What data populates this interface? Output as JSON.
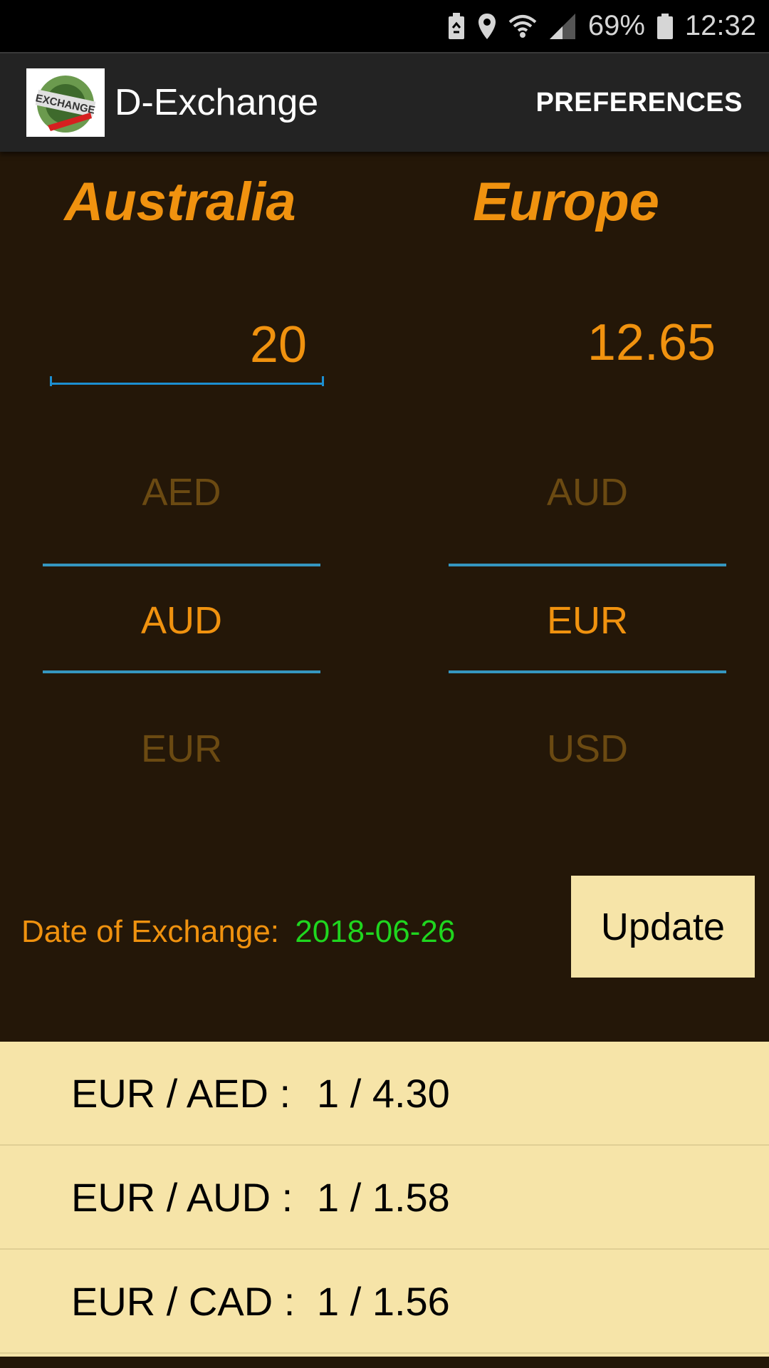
{
  "status_bar": {
    "battery_percent": "69%",
    "time": "12:32",
    "icons": [
      "battery-saver-icon",
      "location-icon",
      "wifi-icon",
      "signal-icon",
      "battery-icon"
    ]
  },
  "app_bar": {
    "title": "D-Exchange",
    "logo_icon": "exchange-logo-icon",
    "preferences_label": "PREFERENCES"
  },
  "converter": {
    "from_country": "Australia",
    "to_country": "Europe",
    "input_value": "20",
    "output_value": "12.65"
  },
  "from_picker": {
    "above": "AED",
    "selected": "AUD",
    "below": "EUR"
  },
  "to_picker": {
    "above": "AUD",
    "selected": "EUR",
    "below": "USD"
  },
  "date": {
    "label": "Date of Exchange:",
    "value": "2018-06-26"
  },
  "update_label": "Update",
  "rates": [
    {
      "pair": "EUR / AED :",
      "value": "1 / 4.30"
    },
    {
      "pair": "EUR / AUD :",
      "value": "1 / 1.58"
    },
    {
      "pair": "EUR / CAD :",
      "value": "1 / 1.56"
    }
  ],
  "colors": {
    "accent": "#f0920f",
    "background": "#241708",
    "date_value": "#1fd61f",
    "picker_line": "#3596c0",
    "rates_bg": "#f6e4a8"
  }
}
